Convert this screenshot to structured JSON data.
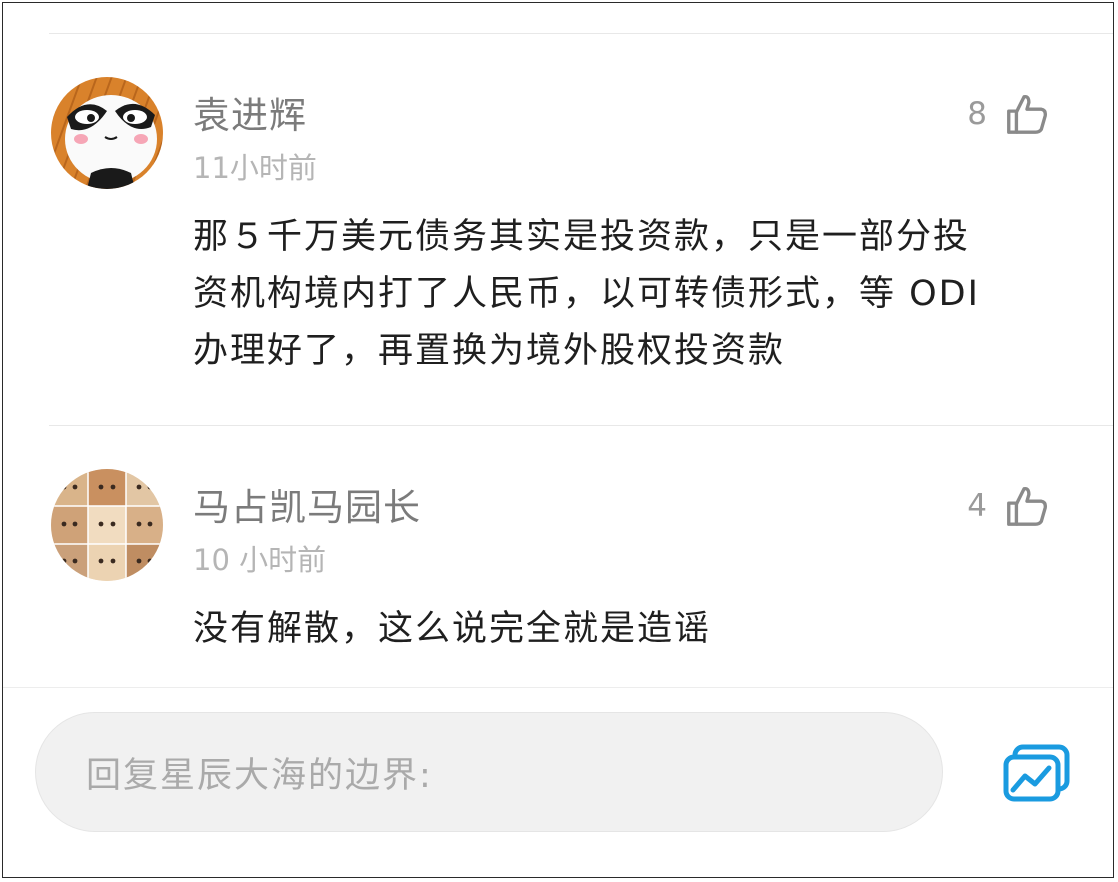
{
  "comments": [
    {
      "username": "袁进辉",
      "time": "11小时前",
      "likes": "8",
      "lines": [
        "那５千万美元债务其实是投资款，只是一部分投",
        "资机构境内打了人民币，以可转债形式，等 ODI",
        "办理好了，再置换为境外股权投资款"
      ],
      "avatar_icon": "panda-avatar-icon"
    },
    {
      "username": "马占凯马园长",
      "time": "10 小时前",
      "likes": "4",
      "lines": [
        "没有解散，这么说完全就是造谣"
      ],
      "avatar_icon": "dog-collage-avatar-icon"
    }
  ],
  "reply": {
    "placeholder": "回复星辰大海的边界:"
  },
  "colors": {
    "accent": "#1a9be0",
    "username": "#7b7b7b",
    "time": "#b5b5b5",
    "body": "#1f1f1f"
  }
}
